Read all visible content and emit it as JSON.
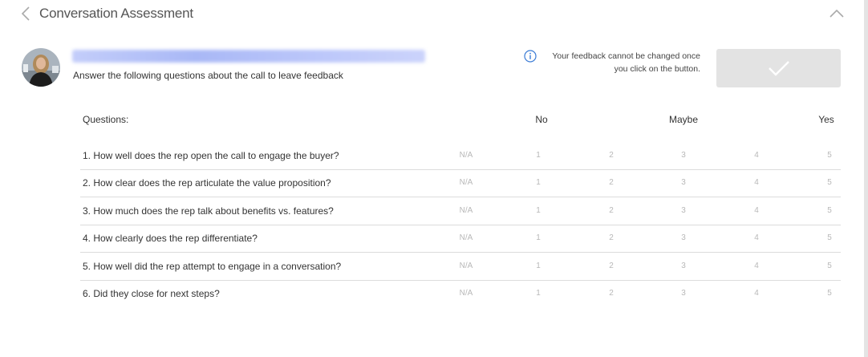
{
  "header": {
    "title": "Conversation Assessment"
  },
  "call": {
    "instruction": "Answer the following questions about the call to leave feedback"
  },
  "notice": {
    "line1": "Your feedback cannot be changed once",
    "line2": "you click on the button."
  },
  "table": {
    "questions_label": "Questions:",
    "scale_labels": {
      "no": "No",
      "maybe": "Maybe",
      "yes": "Yes"
    },
    "options": [
      "N/A",
      "1",
      "2",
      "3",
      "4",
      "5"
    ],
    "questions": [
      "1. How well does the rep open the call to engage the buyer?",
      "2. How clear does the rep articulate the value proposition?",
      "3. How much does the rep talk about benefits vs. features?",
      "4. How clearly does the rep differentiate?",
      "5. How well did the rep attempt to engage in a conversation?",
      "6. Did they close for next steps?"
    ]
  },
  "icons": {
    "back": "chevron-left-icon",
    "collapse": "chevron-up-icon",
    "info": "info-icon",
    "submit": "checkmark-icon"
  },
  "colors": {
    "info_blue": "#3a7bd5",
    "submit_bg": "#e3e3e3",
    "option_text": "#b8b8b8",
    "divider": "#dcdcdc"
  }
}
